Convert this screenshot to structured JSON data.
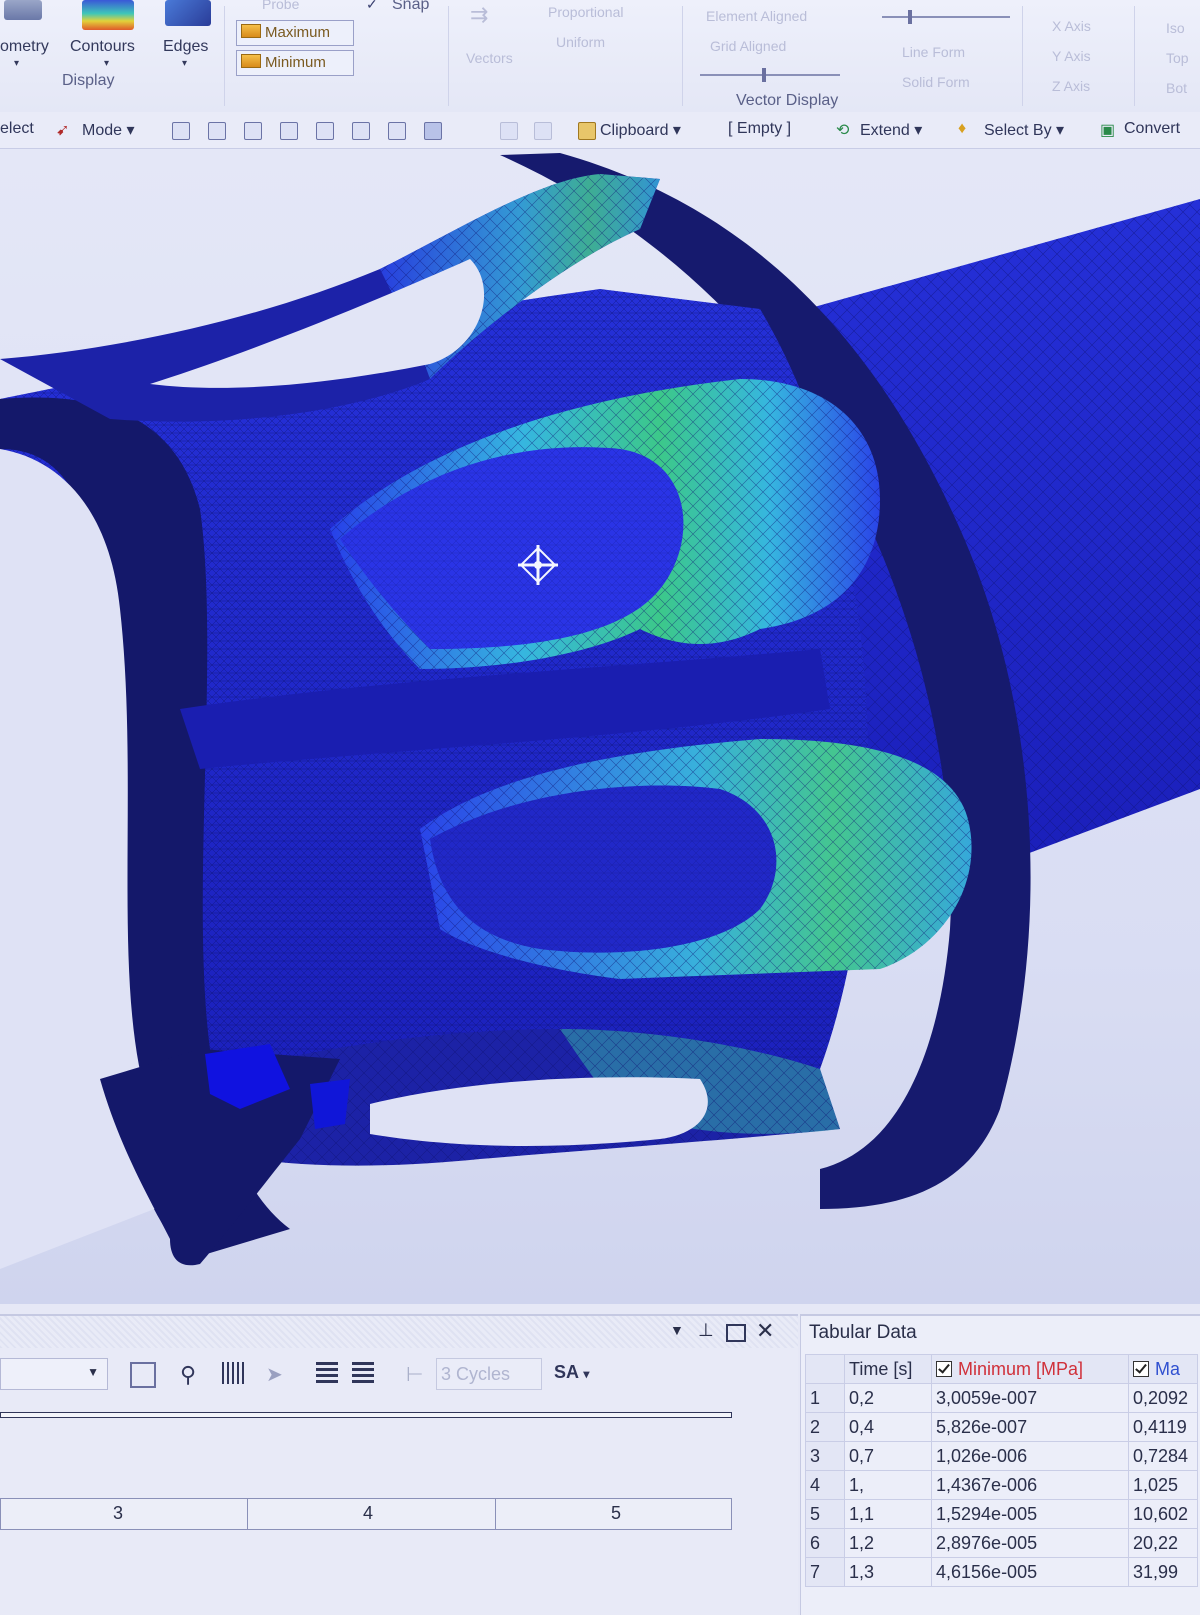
{
  "ribbon": {
    "display_group": {
      "geometry_label": "ometry",
      "contours_label": "Contours",
      "edges_label": "Edges",
      "group_label": "Display"
    },
    "probe_label": "Probe",
    "maximum_label": "Maximum",
    "minimum_label": "Minimum",
    "snap_label": "Snap",
    "vectors_label": "Vectors",
    "proportional_label": "Proportional",
    "uniform_label": "Uniform",
    "element_aligned_label": "Element Aligned",
    "grid_aligned_label": "Grid Aligned",
    "line_form_label": "Line Form",
    "solid_form_label": "Solid Form",
    "vector_display_label": "Vector Display",
    "x_axis_label": "X Axis",
    "y_axis_label": "Y Axis",
    "z_axis_label": "Z Axis",
    "iso_label": "Iso",
    "top_label": "Top",
    "bottom_label": "Bot"
  },
  "toolbar": {
    "select_label": "elect",
    "mode_label": "Mode",
    "clipboard_label": "Clipboard",
    "empty_label": "[ Empty ]",
    "extend_label": "Extend",
    "select_by_label": "Select By",
    "convert_label": "Convert"
  },
  "graph_panel": {
    "cycles_label": "3 Cycles",
    "sa_label": "SA",
    "axis_ticks": [
      "3",
      "4",
      "5"
    ]
  },
  "tabular_data": {
    "title": "Tabular Data",
    "columns": [
      "Time [s]",
      "Minimum [MPa]",
      "Ma"
    ],
    "rows": [
      {
        "n": "1",
        "time": "0,2",
        "min": "3,0059e-007",
        "max": "0,2092"
      },
      {
        "n": "2",
        "time": "0,4",
        "min": "5,826e-007",
        "max": "0,4119"
      },
      {
        "n": "3",
        "time": "0,7",
        "min": "1,026e-006",
        "max": "0,7284"
      },
      {
        "n": "4",
        "time": "1,",
        "min": "1,4367e-006",
        "max": "1,025"
      },
      {
        "n": "5",
        "time": "1,1",
        "min": "1,5294e-005",
        "max": "10,602"
      },
      {
        "n": "6",
        "time": "1,2",
        "min": "2,8976e-005",
        "max": "20,22"
      },
      {
        "n": "7",
        "time": "1,3",
        "min": "4,6156e-005",
        "max": "31,99"
      }
    ]
  },
  "colors": {
    "mesh_dark_blue": "#1a1ec8",
    "mesh_mid_blue": "#2e3cf0",
    "stress_cyan": "#36b6e0",
    "stress_green": "#3cc88a",
    "frame_navy": "#161a6e",
    "minimum_column_red": "#d0303a"
  }
}
